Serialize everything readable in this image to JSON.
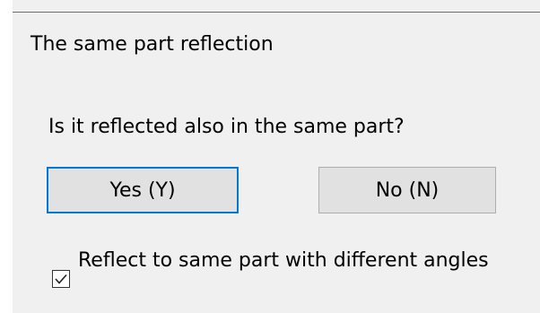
{
  "dialog": {
    "title": "The same part reflection",
    "question": "Is it reflected also in the same part?",
    "yes_label": "Yes (Y)",
    "no_label": "No (N)",
    "checkbox_label": "Reflect to same part with different angles",
    "checkbox_checked": true
  },
  "colors": {
    "accent": "#0078d7",
    "dialog_background": "#f0f0f0",
    "button_background": "#e1e1e1"
  },
  "icons": {
    "checkbox_mark": "check-icon"
  }
}
